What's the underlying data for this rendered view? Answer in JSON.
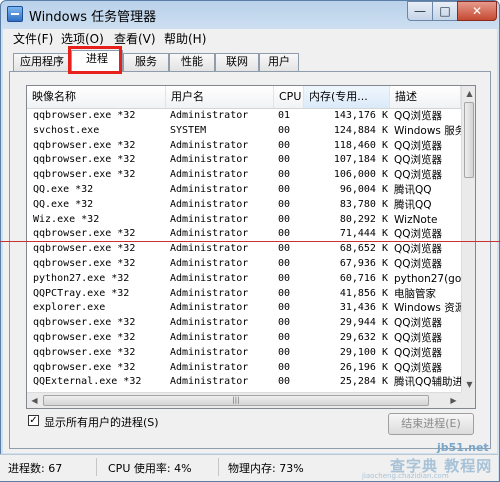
{
  "window": {
    "title": "Windows 任务管理器",
    "minimize": "—",
    "maximize": "□",
    "close": "✕"
  },
  "menu": [
    "文件(F)",
    "选项(O)",
    "查看(V)",
    "帮助(H)"
  ],
  "tabs": [
    "应用程序",
    "进程",
    "服务",
    "性能",
    "联网",
    "用户"
  ],
  "active_tab": "进程",
  "highlight_color": "#e8201c",
  "table": {
    "columns": [
      "映像名称",
      "用户名",
      "CPU",
      "内存(专用...",
      "描述"
    ],
    "rows": [
      [
        "qqbrowser.exe *32",
        "Administrator",
        "01",
        "143,176 K",
        "QQ浏览器"
      ],
      [
        "svchost.exe",
        "SYSTEM",
        "00",
        "124,884 K",
        "Windows 服务"
      ],
      [
        "qqbrowser.exe *32",
        "Administrator",
        "00",
        "118,460 K",
        "QQ浏览器"
      ],
      [
        "qqbrowser.exe *32",
        "Administrator",
        "00",
        "107,184 K",
        "QQ浏览器"
      ],
      [
        "qqbrowser.exe *32",
        "Administrator",
        "00",
        "106,000 K",
        "QQ浏览器"
      ],
      [
        "QQ.exe *32",
        "Administrator",
        "00",
        "96,004 K",
        "腾讯QQ"
      ],
      [
        "QQ.exe *32",
        "Administrator",
        "00",
        "83,780 K",
        "腾讯QQ"
      ],
      [
        "Wiz.exe *32",
        "Administrator",
        "00",
        "80,292 K",
        "WizNote"
      ],
      [
        "qqbrowser.exe *32",
        "Administrator",
        "00",
        "71,444 K",
        "QQ浏览器"
      ],
      [
        "qqbrowser.exe *32",
        "Administrator",
        "00",
        "68,652 K",
        "QQ浏览器"
      ],
      [
        "qqbrowser.exe *32",
        "Administrator",
        "00",
        "67,936 K",
        "QQ浏览器"
      ],
      [
        "python27.exe *32",
        "Administrator",
        "00",
        "60,716 K",
        "python27(goa"
      ],
      [
        "QQPCTray.exe *32",
        "Administrator",
        "00",
        "41,856 K",
        "电脑管家"
      ],
      [
        "explorer.exe",
        "Administrator",
        "00",
        "31,436 K",
        "Windows 资源"
      ],
      [
        "qqbrowser.exe *32",
        "Administrator",
        "00",
        "29,944 K",
        "QQ浏览器"
      ],
      [
        "qqbrowser.exe *32",
        "Administrator",
        "00",
        "29,632 K",
        "QQ浏览器"
      ],
      [
        "qqbrowser.exe *32",
        "Administrator",
        "00",
        "29,100 K",
        "QQ浏览器"
      ],
      [
        "qqbrowser.exe *32",
        "Administrator",
        "00",
        "26,196 K",
        "QQ浏览器"
      ],
      [
        "QQExternal.exe *32",
        "Administrator",
        "00",
        "25,284 K",
        "腾讯QQ辅助进"
      ]
    ]
  },
  "show_all_checkbox": {
    "label": "显示所有用户的进程(S)",
    "checked": true,
    "mark": "✓"
  },
  "end_process_button": "结束进程(E)",
  "status": {
    "processes": "进程数: 67",
    "cpu": "CPU 使用率: 4%",
    "memory": "物理内存: 73%"
  },
  "watermark": {
    "site": "jb51.net",
    "brand": "查字典 教程网",
    "url": "jiaocheng.chazidian.com"
  }
}
